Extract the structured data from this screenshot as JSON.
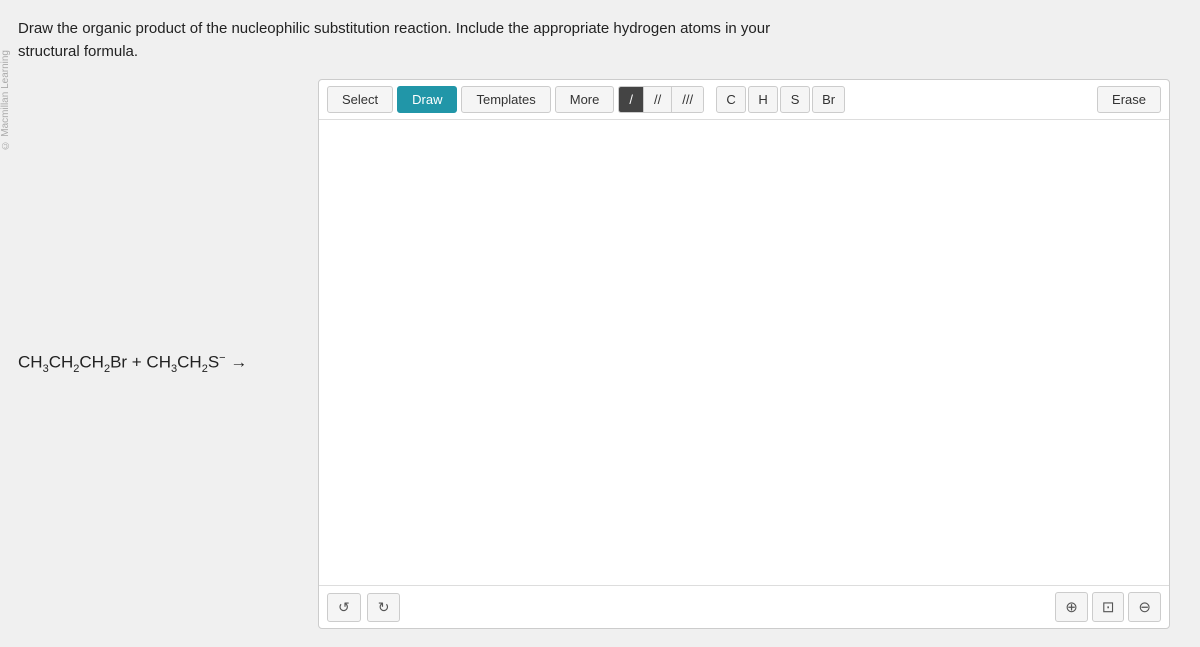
{
  "question": {
    "line1": "Draw the organic product of the nucleophilic substitution reaction. Include the appropriate hydrogen atoms in your",
    "line2": "structural formula."
  },
  "watermark": "© Macmillan Learning",
  "reaction": {
    "formula_html": "CH₃CH₂CH₂Br + CH₃CH₂S⁻ →"
  },
  "toolbar": {
    "select_label": "Select",
    "draw_label": "Draw",
    "templates_label": "Templates",
    "more_label": "More",
    "erase_label": "Erase"
  },
  "bonds": {
    "single": "/",
    "double": "//",
    "triple": "///"
  },
  "atoms": {
    "c": "C",
    "h": "H",
    "s": "S",
    "br": "Br"
  },
  "bottom_controls": {
    "undo_icon": "↺",
    "redo_icon": "↻",
    "zoom_in_icon": "⊕",
    "zoom_fit_icon": "⊡",
    "zoom_out_icon": "⊖"
  }
}
